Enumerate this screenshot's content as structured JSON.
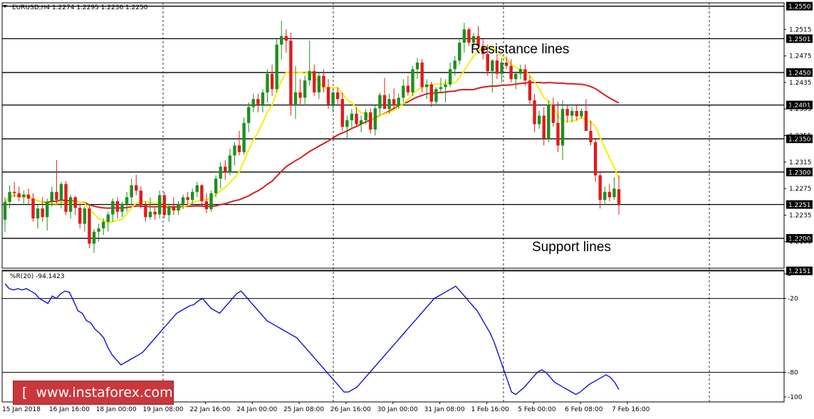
{
  "header": {
    "symbol_line": "EURUSD,H4  1.2274 1.2295 1.2236 1.2250"
  },
  "indicator": {
    "label": "%R(20) -94.1423"
  },
  "annotations": {
    "resistance": "Resistance lines",
    "support": "Support lines"
  },
  "watermark": {
    "text": "[  www.instaforex.com ]"
  },
  "colors": {
    "bull_candle": "#1e8f1e",
    "bear_candle": "#e01b1b",
    "fast_ma": "#f5f000",
    "slow_ma": "#d61e1e",
    "williams_r": "#1010d0",
    "price_label_bg": "#000000",
    "watermark_bg": "#c8383d"
  },
  "chart_data": [
    {
      "type": "candlestick",
      "timeframe": "H4",
      "ylim": [
        1.2155,
        1.2555
      ],
      "y_ticks": [
        "1.2515",
        "1.2475",
        "1.2435",
        "1.2395",
        "1.2355",
        "1.2315",
        "1.2275",
        "1.2235",
        "1.2195"
      ],
      "level_lines": [
        "1.2550",
        "1.2501",
        "1.2450",
        "1.2401",
        "1.2350",
        "1.2300",
        "1.2251",
        "1.2200",
        "1.2151"
      ],
      "x_labels": [
        "15 Jan 2018",
        "16 Jan 16:00",
        "18 Jan 00:00",
        "19 Jan 08:00",
        "22 Jan 16:00",
        "24 Jan 00:00",
        "25 Jan 08:00",
        "26 Jan 16:00",
        "30 Jan 00:00",
        "31 Jan 08:00",
        "1 Feb 16:00",
        "5 Feb 00:00",
        "6 Feb 08:00",
        "7 Feb 16:00"
      ],
      "grid": "vertical dashed separators",
      "candles_ohlc": [
        [
          1.2228,
          1.2262,
          1.221,
          1.2255
        ],
        [
          1.2255,
          1.228,
          1.2245,
          1.227
        ],
        [
          1.227,
          1.2285,
          1.2262,
          1.2268
        ],
        [
          1.2268,
          1.2278,
          1.2256,
          1.2262
        ],
        [
          1.2262,
          1.2272,
          1.225,
          1.2266
        ],
        [
          1.2266,
          1.2275,
          1.225,
          1.226
        ],
        [
          1.226,
          1.2268,
          1.2225,
          1.223
        ],
        [
          1.223,
          1.225,
          1.2215,
          1.2245
        ],
        [
          1.2245,
          1.2262,
          1.2225,
          1.2232
        ],
        [
          1.2232,
          1.226,
          1.2212,
          1.2255
        ],
        [
          1.2255,
          1.2278,
          1.2248,
          1.227
        ],
        [
          1.227,
          1.2318,
          1.2252,
          1.2258
        ],
        [
          1.2258,
          1.2285,
          1.2245,
          1.2282
        ],
        [
          1.2282,
          1.2286,
          1.2235,
          1.224
        ],
        [
          1.224,
          1.2266,
          1.223,
          1.2262
        ],
        [
          1.2262,
          1.2264,
          1.2235,
          1.2246
        ],
        [
          1.2246,
          1.2252,
          1.2215,
          1.2222
        ],
        [
          1.2222,
          1.2248,
          1.221,
          1.2245
        ],
        [
          1.2245,
          1.225,
          1.2185,
          1.2192
        ],
        [
          1.2192,
          1.2214,
          1.2178,
          1.221
        ],
        [
          1.221,
          1.2222,
          1.2195,
          1.2215
        ],
        [
          1.2215,
          1.223,
          1.2205,
          1.2225
        ],
        [
          1.2225,
          1.224,
          1.221,
          1.2236
        ],
        [
          1.2236,
          1.226,
          1.2225,
          1.2256
        ],
        [
          1.2256,
          1.2262,
          1.223,
          1.224
        ],
        [
          1.224,
          1.2255,
          1.2232,
          1.2252
        ],
        [
          1.2252,
          1.227,
          1.224,
          1.2262
        ],
        [
          1.2262,
          1.229,
          1.225,
          1.228
        ],
        [
          1.228,
          1.2296,
          1.2265,
          1.2272
        ],
        [
          1.2272,
          1.2278,
          1.2245,
          1.225
        ],
        [
          1.225,
          1.2256,
          1.2225,
          1.2232
        ],
        [
          1.2232,
          1.2262,
          1.2228,
          1.224
        ],
        [
          1.224,
          1.2246,
          1.2228,
          1.2236
        ],
        [
          1.2236,
          1.2272,
          1.223,
          1.2265
        ],
        [
          1.2265,
          1.227,
          1.223,
          1.2235
        ],
        [
          1.2235,
          1.2252,
          1.2225,
          1.2248
        ],
        [
          1.2248,
          1.2262,
          1.2235,
          1.2242
        ],
        [
          1.2242,
          1.2256,
          1.2235,
          1.2252
        ],
        [
          1.2252,
          1.2266,
          1.2244,
          1.2262
        ],
        [
          1.2262,
          1.227,
          1.225,
          1.2258
        ],
        [
          1.2258,
          1.2275,
          1.2252,
          1.227
        ],
        [
          1.227,
          1.2285,
          1.2262,
          1.228
        ],
        [
          1.228,
          1.2282,
          1.2248,
          1.2256
        ],
        [
          1.2256,
          1.2268,
          1.2238,
          1.2244
        ],
        [
          1.2244,
          1.2272,
          1.224,
          1.2268
        ],
        [
          1.2268,
          1.2295,
          1.2262,
          1.229
        ],
        [
          1.229,
          1.2315,
          1.2275,
          1.2308
        ],
        [
          1.2308,
          1.2318,
          1.2288,
          1.23
        ],
        [
          1.23,
          1.2335,
          1.2295,
          1.2325
        ],
        [
          1.2325,
          1.2345,
          1.231,
          1.234
        ],
        [
          1.234,
          1.2362,
          1.2325,
          1.233
        ],
        [
          1.233,
          1.2382,
          1.2326,
          1.2374
        ],
        [
          1.2374,
          1.2405,
          1.236,
          1.2398
        ],
        [
          1.2398,
          1.2418,
          1.239,
          1.241
        ],
        [
          1.241,
          1.2418,
          1.239,
          1.2402
        ],
        [
          1.2402,
          1.2425,
          1.239,
          1.242
        ],
        [
          1.242,
          1.2455,
          1.2405,
          1.2448
        ],
        [
          1.2448,
          1.2462,
          1.2415,
          1.2425
        ],
        [
          1.2425,
          1.25,
          1.242,
          1.2492
        ],
        [
          1.2492,
          1.2528,
          1.247,
          1.2505
        ],
        [
          1.2505,
          1.2515,
          1.248,
          1.2498
        ],
        [
          1.2498,
          1.251,
          1.2385,
          1.24
        ],
        [
          1.24,
          1.246,
          1.238,
          1.242
        ],
        [
          1.242,
          1.244,
          1.24,
          1.2412
        ],
        [
          1.2412,
          1.2445,
          1.24,
          1.2438
        ],
        [
          1.2438,
          1.2498,
          1.243,
          1.2452
        ],
        [
          1.2452,
          1.2462,
          1.2415,
          1.242
        ],
        [
          1.242,
          1.245,
          1.241,
          1.2445
        ],
        [
          1.2445,
          1.2455,
          1.242,
          1.2428
        ],
        [
          1.2428,
          1.244,
          1.2395,
          1.2402
        ],
        [
          1.2402,
          1.2425,
          1.239,
          1.242
        ],
        [
          1.242,
          1.2428,
          1.24,
          1.241
        ],
        [
          1.241,
          1.242,
          1.2362,
          1.2368
        ],
        [
          1.2368,
          1.2385,
          1.235,
          1.2378
        ],
        [
          1.2378,
          1.2395,
          1.2366,
          1.2388
        ],
        [
          1.2388,
          1.2398,
          1.2368,
          1.2372
        ],
        [
          1.2372,
          1.2385,
          1.236,
          1.2378
        ],
        [
          1.2378,
          1.2395,
          1.2372,
          1.239
        ],
        [
          1.239,
          1.2396,
          1.2358,
          1.2364
        ],
        [
          1.2364,
          1.24,
          1.2355,
          1.2396
        ],
        [
          1.2396,
          1.242,
          1.2385,
          1.2416
        ],
        [
          1.2416,
          1.2442,
          1.2405,
          1.2395
        ],
        [
          1.2395,
          1.2418,
          1.2388,
          1.241
        ],
        [
          1.241,
          1.2426,
          1.2395,
          1.24
        ],
        [
          1.24,
          1.2418,
          1.2395,
          1.2412
        ],
        [
          1.2412,
          1.244,
          1.2405,
          1.243
        ],
        [
          1.243,
          1.2445,
          1.2415,
          1.242
        ],
        [
          1.242,
          1.246,
          1.2415,
          1.2455
        ],
        [
          1.2455,
          1.2472,
          1.244,
          1.2465
        ],
        [
          1.2465,
          1.247,
          1.242,
          1.2428
        ],
        [
          1.2428,
          1.244,
          1.241,
          1.2432
        ],
        [
          1.2432,
          1.2436,
          1.2398,
          1.2406
        ],
        [
          1.2406,
          1.2428,
          1.24,
          1.2425
        ],
        [
          1.2425,
          1.2442,
          1.242,
          1.2428
        ],
        [
          1.2428,
          1.244,
          1.2405,
          1.2432
        ],
        [
          1.2432,
          1.2465,
          1.2428,
          1.2455
        ],
        [
          1.2455,
          1.2475,
          1.2445,
          1.2468
        ],
        [
          1.2468,
          1.25,
          1.2462,
          1.2495
        ],
        [
          1.2495,
          1.2525,
          1.248,
          1.2515
        ],
        [
          1.2515,
          1.2518,
          1.249,
          1.2495
        ],
        [
          1.2495,
          1.251,
          1.2488,
          1.2505
        ],
        [
          1.2505,
          1.252,
          1.2485,
          1.249
        ],
        [
          1.249,
          1.25,
          1.247,
          1.2478
        ],
        [
          1.2478,
          1.2492,
          1.2445,
          1.2452
        ],
        [
          1.2452,
          1.247,
          1.242,
          1.2468
        ],
        [
          1.2468,
          1.2478,
          1.244,
          1.2448
        ],
        [
          1.2448,
          1.2472,
          1.2435,
          1.2465
        ],
        [
          1.2465,
          1.2474,
          1.2455,
          1.246
        ],
        [
          1.246,
          1.247,
          1.2435,
          1.244
        ],
        [
          1.244,
          1.2452,
          1.2425,
          1.2448
        ],
        [
          1.2448,
          1.2462,
          1.244,
          1.2455
        ],
        [
          1.2455,
          1.2462,
          1.243,
          1.2438
        ],
        [
          1.2438,
          1.2445,
          1.24,
          1.2408
        ],
        [
          1.2408,
          1.2418,
          1.236,
          1.2372
        ],
        [
          1.2372,
          1.2392,
          1.2365,
          1.2385
        ],
        [
          1.2385,
          1.2398,
          1.234,
          1.235
        ],
        [
          1.235,
          1.2408,
          1.2345,
          1.2402
        ],
        [
          1.2402,
          1.2412,
          1.2368,
          1.2374
        ],
        [
          1.2374,
          1.2406,
          1.233,
          1.234
        ],
        [
          1.234,
          1.2408,
          1.2318,
          1.2395
        ],
        [
          1.2395,
          1.24,
          1.2375,
          1.2385
        ],
        [
          1.2385,
          1.2398,
          1.2375,
          1.2392
        ],
        [
          1.2392,
          1.24,
          1.2378,
          1.2384
        ],
        [
          1.2384,
          1.2396,
          1.238,
          1.2392
        ],
        [
          1.2392,
          1.241,
          1.2385,
          1.2362
        ],
        [
          1.2362,
          1.2378,
          1.234,
          1.2345
        ],
        [
          1.2345,
          1.235,
          1.2285,
          1.2295
        ],
        [
          1.2295,
          1.23,
          1.2245,
          1.2258
        ],
        [
          1.2258,
          1.2278,
          1.225,
          1.227
        ],
        [
          1.227,
          1.2282,
          1.2256,
          1.2262
        ],
        [
          1.2262,
          1.2292,
          1.2258,
          1.2275
        ],
        [
          1.2274,
          1.2295,
          1.2236,
          1.225
        ]
      ]
    },
    {
      "type": "line",
      "title": "%R(20) -94.1423",
      "ylim": [
        -100,
        0
      ],
      "y_ticks": [
        "0",
        "-20",
        "-80",
        "-100"
      ],
      "level_lines": [
        -20,
        -80
      ],
      "values": [
        -8,
        -12,
        -13,
        -12,
        -13,
        -12,
        -14,
        -16,
        -20,
        -22,
        -24,
        -18,
        -20,
        -16,
        -14,
        -15,
        -22,
        -30,
        -32,
        -38,
        -40,
        -45,
        -48,
        -52,
        -60,
        -66,
        -70,
        -74,
        -72,
        -70,
        -68,
        -66,
        -64,
        -60,
        -56,
        -52,
        -48,
        -44,
        -40,
        -36,
        -32,
        -30,
        -28,
        -26,
        -25,
        -22,
        -20,
        -24,
        -28,
        -30,
        -32,
        -28,
        -24,
        -20,
        -16,
        -14,
        -18,
        -22,
        -26,
        -30,
        -34,
        -38,
        -40,
        -42,
        -44,
        -46,
        -48,
        -50,
        -52,
        -56,
        -60,
        -64,
        -68,
        -72,
        -76,
        -80,
        -84,
        -88,
        -92,
        -96,
        -96,
        -94,
        -92,
        -88,
        -84,
        -80,
        -76,
        -72,
        -68,
        -64,
        -60,
        -56,
        -52,
        -48,
        -44,
        -40,
        -36,
        -32,
        -28,
        -24,
        -20,
        -18,
        -16,
        -14,
        -12,
        -10,
        -14,
        -18,
        -22,
        -26,
        -30,
        -36,
        -42,
        -48,
        -56,
        -66,
        -76,
        -86,
        -96,
        -98,
        -95,
        -92,
        -88,
        -84,
        -80,
        -78,
        -80,
        -84,
        -88,
        -90,
        -92,
        -94,
        -96,
        -98,
        -96,
        -93,
        -90,
        -88,
        -86,
        -84,
        -82,
        -84,
        -88,
        -94
      ]
    }
  ]
}
